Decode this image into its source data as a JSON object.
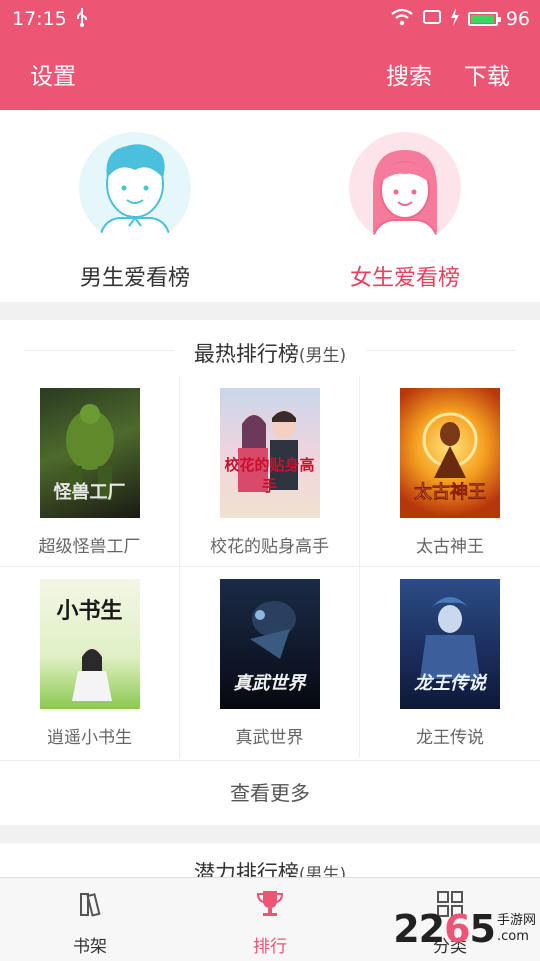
{
  "status_bar": {
    "time": "17:15",
    "battery": "96",
    "battery_level": 0.96
  },
  "app_bar": {
    "left": "设置",
    "search": "搜索",
    "download": "下载"
  },
  "rank_categories": [
    {
      "label": "男生爱看榜",
      "color": "#333333"
    },
    {
      "label": "女生爱看榜",
      "color": "#e8405f"
    }
  ],
  "hot_panel": {
    "title": "最热排行榜",
    "subtitle": "(男生)",
    "books": [
      {
        "name": "超级怪兽工厂",
        "cover_text": "怪兽工厂"
      },
      {
        "name": "校花的贴身高手",
        "cover_text": "校花的贴身高手"
      },
      {
        "name": "太古神王",
        "cover_text": "太古神王"
      },
      {
        "name": "逍遥小书生",
        "cover_text": "小书生"
      },
      {
        "name": "真武世界",
        "cover_text": "真武世界"
      },
      {
        "name": "龙王传说",
        "cover_text": "龙王传说"
      }
    ],
    "more": "查看更多"
  },
  "potential_panel": {
    "title": "潜力排行榜",
    "subtitle": "(男生)"
  },
  "tabs": [
    {
      "label": "书架",
      "icon": "bookshelf-icon"
    },
    {
      "label": "排行",
      "icon": "trophy-icon",
      "active": true
    },
    {
      "label": "分类",
      "icon": "grid-icon"
    }
  ],
  "watermark": {
    "prefix": "22",
    "accent": "6",
    "suffix": "5",
    "line1": "手游网",
    "line2": ".com"
  },
  "colors": {
    "brand": "#ec5574",
    "active_tab": "#ec5574",
    "female_label": "#e8405f"
  }
}
